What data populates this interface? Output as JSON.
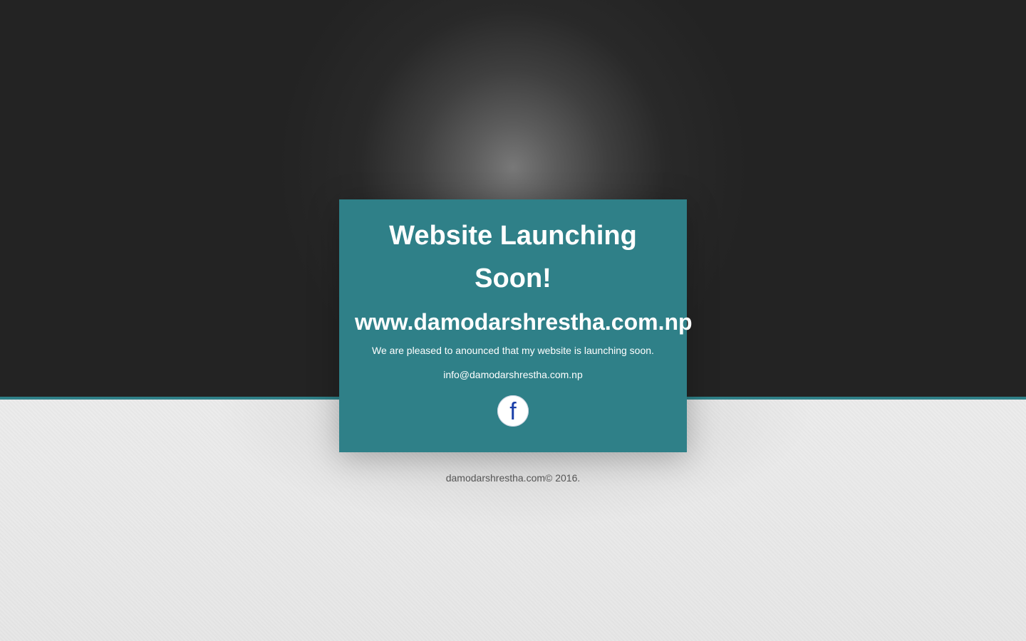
{
  "card": {
    "title": "Website Launching Soon!",
    "domain": "www.damodarshrestha.com.np",
    "message": "We are pleased to anounced that my website is launching soon.",
    "email": "info@damodarshrestha.com.np",
    "facebook_glyph": "f"
  },
  "icons": {
    "facebook": "facebook-icon"
  },
  "footer": {
    "copyright": "damodarshrestha.com© 2016."
  },
  "colors": {
    "accent": "#2f8088",
    "top_background": "#232323",
    "bottom_background": "#e8e8e8",
    "facebook_blue": "#1a3fa8"
  }
}
